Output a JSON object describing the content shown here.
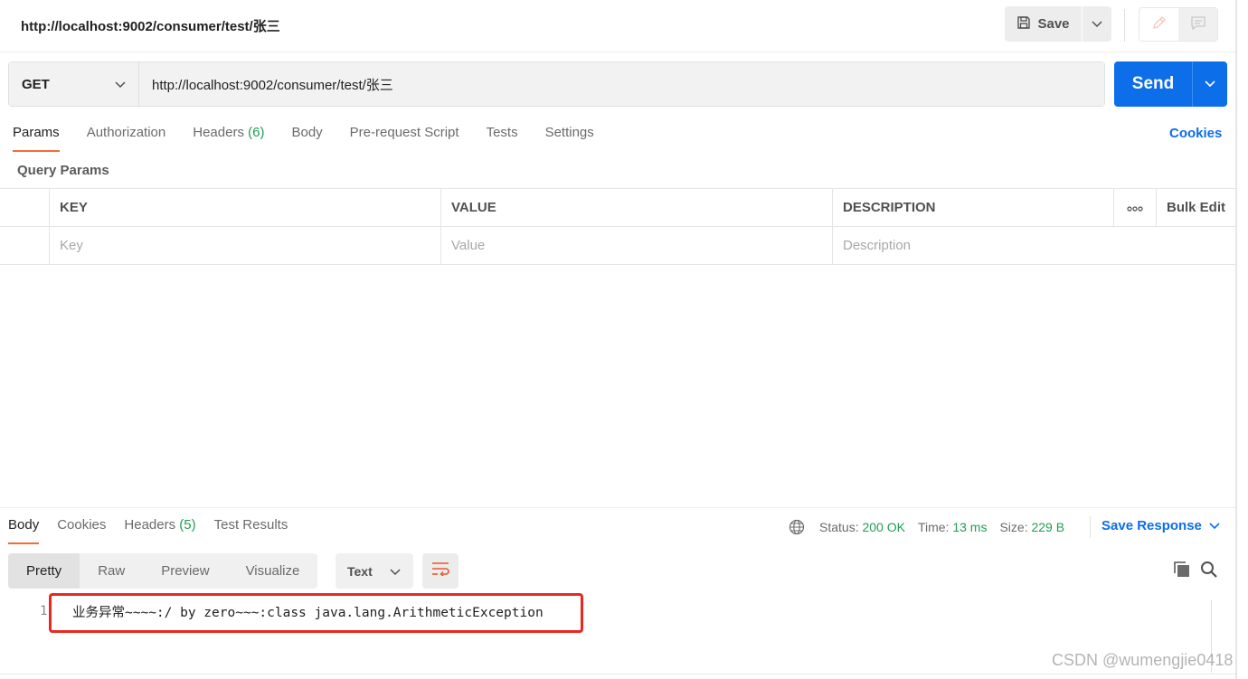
{
  "tab": {
    "title": "http://localhost:9002/consumer/test/张三"
  },
  "toolbar": {
    "save_label": "Save"
  },
  "request": {
    "method": "GET",
    "url": "http://localhost:9002/consumer/test/张三",
    "send_label": "Send",
    "tabs": [
      {
        "label": "Params",
        "count": ""
      },
      {
        "label": "Authorization",
        "count": ""
      },
      {
        "label": "Headers",
        "count": "(6)"
      },
      {
        "label": "Body",
        "count": ""
      },
      {
        "label": "Pre-request Script",
        "count": ""
      },
      {
        "label": "Tests",
        "count": ""
      },
      {
        "label": "Settings",
        "count": ""
      }
    ],
    "cookies_label": "Cookies"
  },
  "params": {
    "section_title": "Query Params",
    "columns": {
      "key": "KEY",
      "value": "VALUE",
      "description": "DESCRIPTION",
      "bulk_edit": "Bulk Edit"
    },
    "placeholders": {
      "key": "Key",
      "value": "Value",
      "description": "Description"
    }
  },
  "response": {
    "tabs": [
      {
        "label": "Body",
        "count": ""
      },
      {
        "label": "Cookies",
        "count": ""
      },
      {
        "label": "Headers",
        "count": "(5)"
      },
      {
        "label": "Test Results",
        "count": ""
      }
    ],
    "status_label": "Status:",
    "status_value": "200 OK",
    "time_label": "Time:",
    "time_value": "13 ms",
    "size_label": "Size:",
    "size_value": "229 B",
    "save_response_label": "Save Response",
    "formats": [
      "Pretty",
      "Raw",
      "Preview",
      "Visualize"
    ],
    "text_type": "Text",
    "body_lines": [
      {
        "number": "1",
        "text": "业务异常~~~~:/ by zero~~~:class java.lang.ArithmeticException"
      }
    ]
  },
  "watermark": "CSDN @wumengjie0418",
  "colors": {
    "accent_blue": "#0c6ee8",
    "tab_underline": "#f26b3a",
    "count_green": "#1f9d55",
    "highlight_red": "#e8281f"
  }
}
